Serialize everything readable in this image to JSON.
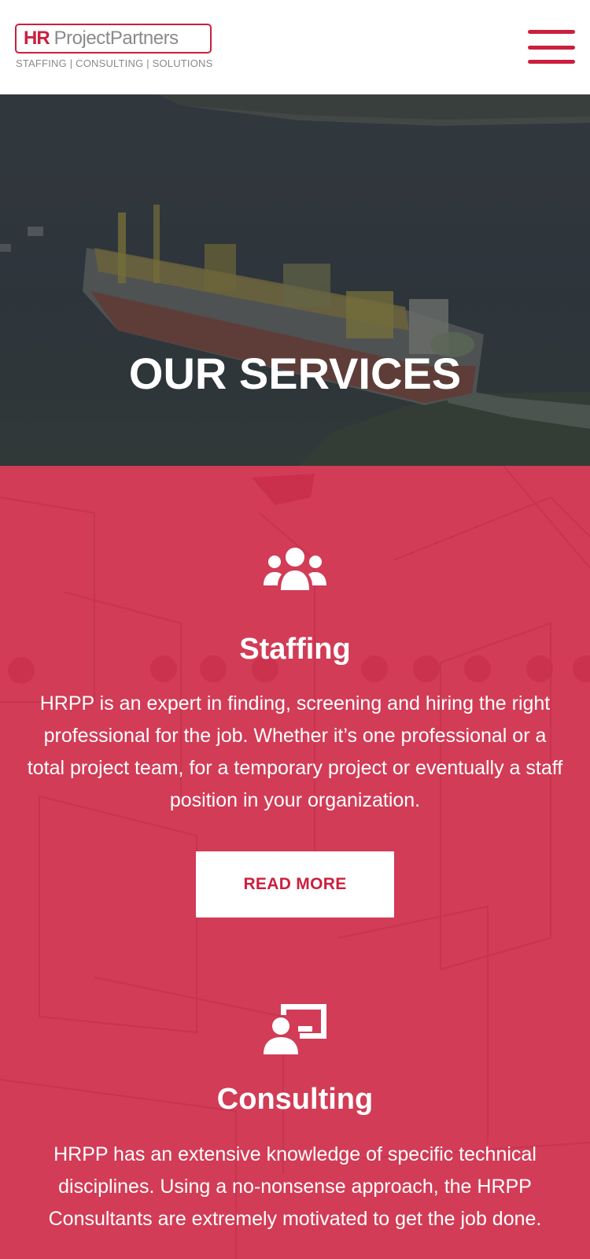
{
  "header": {
    "logo_hr": "HR",
    "logo_name": "ProjectPartners",
    "logo_tagline": "STAFFING | CONSULTING | SOLUTIONS"
  },
  "hero": {
    "title": "OUR SERVICES"
  },
  "services": [
    {
      "icon": "users-group-icon",
      "title": "Staffing",
      "description": "HRPP is an expert in finding, screening and hiring the right professional for the job. Whether it’s one professional or a total project team, for a temporary project or eventually a staff position in your organization.",
      "button_label": "READ MORE"
    },
    {
      "icon": "presentation-user-icon",
      "title": "Consulting",
      "description": "HRPP has an extensive knowledge of specific technical disciplines. Using a no-nonsense approach, the HRPP Consultants are extremely motivated to get the job done."
    }
  ],
  "colors": {
    "brand_red": "#cc1f3e",
    "section_red": "#d23c56",
    "logo_grey": "#8a8a8a"
  }
}
